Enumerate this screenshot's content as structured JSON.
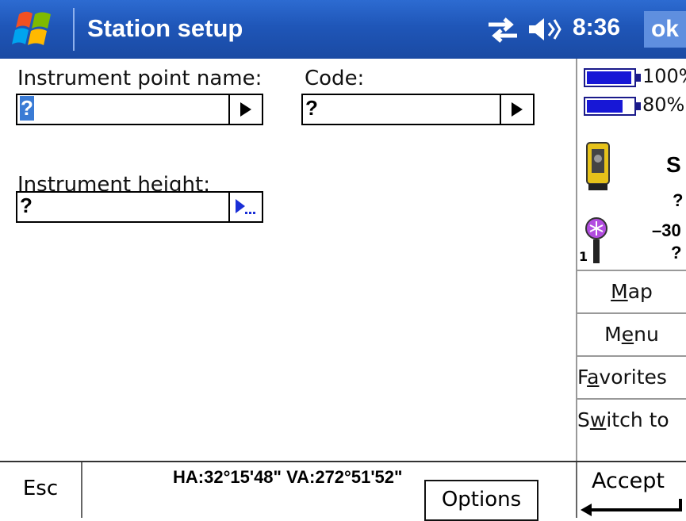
{
  "header": {
    "title": "Station setup",
    "time": "8:36",
    "ok_label": "ok"
  },
  "form": {
    "instrument_point_label": "Instrument point name:",
    "instrument_point_value": "?",
    "code_label": "Code:",
    "code_value": "?",
    "instrument_height_label": "Instrument height:",
    "instrument_height_value": "?"
  },
  "status": {
    "battery1_text": "100%",
    "battery1_level": 1.0,
    "battery2_text": "80%",
    "battery2_level": 0.8,
    "instrument_letter": "S",
    "instrument_value": "?",
    "target_number": "1",
    "target_value": "–30",
    "target_sub": "?"
  },
  "side_buttons": [
    {
      "pre": "",
      "ul": "M",
      "post": "ap"
    },
    {
      "pre": "M",
      "ul": "e",
      "post": "nu"
    },
    {
      "pre": "F",
      "ul": "a",
      "post": "vorites"
    },
    {
      "pre": "S",
      "ul": "w",
      "post": "itch to"
    }
  ],
  "footer": {
    "esc_label": "Esc",
    "angles": "HA:32°15'48\"   VA:272°51'52\"",
    "options_label": "Options",
    "accept_label": "Accept"
  },
  "colors": {
    "title_bar": "#1f56b8",
    "ok_button": "#5f8fdf",
    "battery_fill": "#1717d6",
    "selection": "#3a7bd5"
  },
  "icons": [
    "windows-start-icon",
    "connectivity-icon",
    "volume-icon",
    "battery-icon",
    "total-station-icon",
    "target-prism-icon",
    "play-arrow-icon",
    "ellipsis-arrow-icon"
  ]
}
